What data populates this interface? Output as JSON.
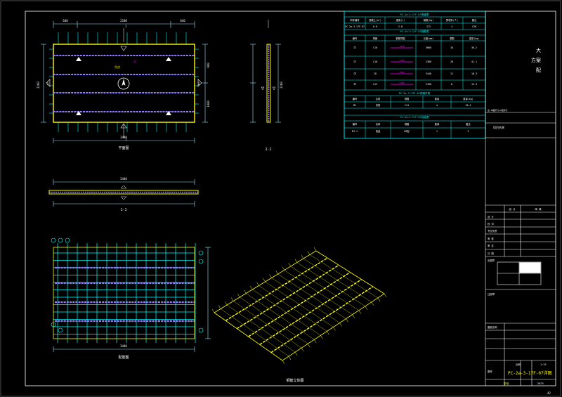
{
  "drawing": {
    "plan_title": "平面图",
    "section_1_label": "1-1",
    "section_2_label": "2-2",
    "rebar_plan_title": "配筋图",
    "iso_title": "钢筋立体图",
    "page_corner": "42",
    "dims": {
      "top_left": "640",
      "top_mid": "2180",
      "top_right": "640",
      "bottom_total": "3440",
      "left_total": "2160",
      "right_segment_a": "900",
      "right_segment_b": "1040",
      "s1_total": "3440",
      "s2_total": "2160",
      "rebar_bottom": "3440",
      "section_thk": "130"
    },
    "marks": {
      "s1_top": "1",
      "s1_bottom": "1",
      "s2_left": "2",
      "s2_right": "2",
      "rebar_tag": "⑤",
      "lift_label": "吊点"
    }
  },
  "tables": {
    "table1": {
      "title": "PC-2a-3-17F-07明细表",
      "headers": [
        "构件编号",
        "混凝土(m³)",
        "重量(t)",
        "钢筋(kg)",
        "预埋件(个)",
        "备注"
      ],
      "row": [
        "PC-2a-3-17F-07",
        "0.8",
        "2.0",
        "172",
        "4",
        "C30"
      ]
    },
    "table2": {
      "title": "PC-2a-3-17F-07钢筋表",
      "headers": [
        "编号",
        "规格",
        "钢筋简图",
        "长度(mm)",
        "根数",
        "重量(kg)"
      ],
      "rows": [
        [
          "①",
          "C10",
          "3440",
          "3660",
          "16",
          "36.2"
        ],
        [
          "②",
          "C10",
          "2160",
          "2380",
          "28",
          "41.1"
        ],
        [
          "③",
          "C8",
          "3440",
          "3440",
          "12",
          "16.3"
        ],
        [
          "④",
          "C12",
          "2160",
          "2160",
          "8",
          "15.3"
        ]
      ]
    },
    "table3": {
      "title": "PC-2a-3-17F-07预埋件表",
      "headers": [
        "编号",
        "名称",
        "规格",
        "数量",
        "重量(kg)"
      ],
      "row": [
        "M1",
        "吊钩",
        "C14",
        "4",
        "10.4"
      ]
    },
    "table4": {
      "title": "PC-2a-3-17F-07其他表",
      "headers": [
        "编号",
        "名称",
        "规格",
        "数量",
        "备注"
      ],
      "row": [
        "MJ-1",
        "线盒",
        "86型",
        "1",
        "3"
      ]
    }
  },
  "title_block": {
    "company": "大方案配",
    "project_label": "项目名称",
    "note_line": "注:本图尺寸以毫米计",
    "col_left": "设 计",
    "col_right": "审 核",
    "rows": [
      "设 计",
      "校 对",
      "专业负责",
      "审 核",
      "审 定",
      "日 期"
    ],
    "stamp_label": "出图章",
    "cert_label": "注册章",
    "sheet_title_label": "图纸名称",
    "scale_label": "比例",
    "scale_value": "1:25",
    "drawing_no_label": "图号",
    "drawing_name": "PC-2a-3-17F-07详图",
    "stage_label": "阶段",
    "sheet_no": "2023",
    "accent_yellow": "#ffff00"
  },
  "colors": {
    "background": "#000000",
    "cyan": "#00ffff",
    "yellow": "#ffff00",
    "magenta": "#ff00ff",
    "purple": "#8f7cff",
    "white": "#ffffff",
    "blue_table": "#1e4fff"
  }
}
